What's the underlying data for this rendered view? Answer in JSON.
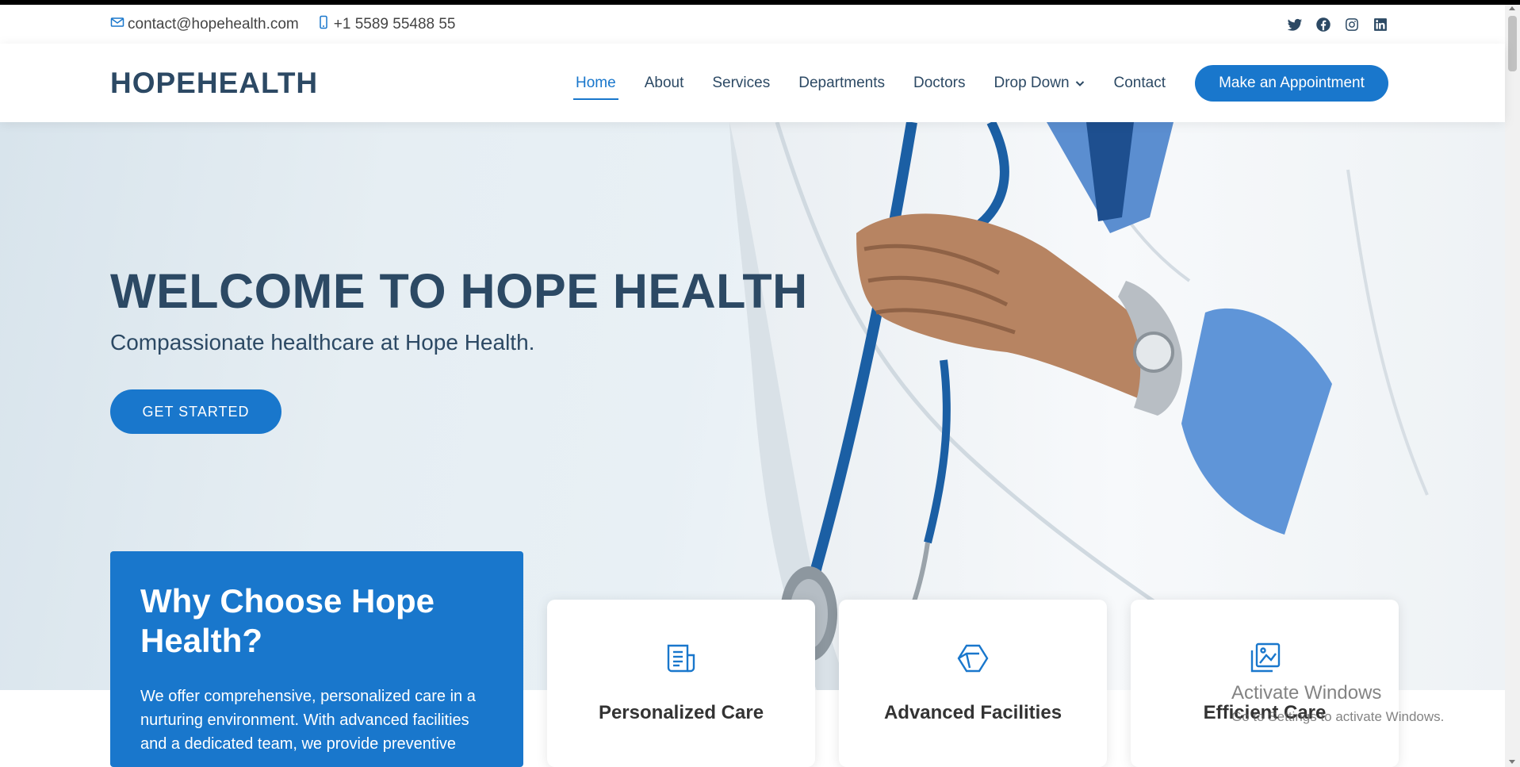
{
  "topbar": {
    "email": "contact@hopehealth.com",
    "phone": "+1 5589 55488 55",
    "social_icons": [
      "twitter-icon",
      "facebook-icon",
      "instagram-icon",
      "linkedin-icon"
    ]
  },
  "header": {
    "logo": "HOPEHEALTH",
    "nav": [
      "Home",
      "About",
      "Services",
      "Departments",
      "Doctors",
      "Drop Down",
      "Contact"
    ],
    "active_nav": "Home",
    "cta": "Make an Appointment"
  },
  "hero": {
    "title": "WELCOME TO HOPE HEALTH",
    "subtitle": "Compassionate healthcare at Hope Health.",
    "button": "GET STARTED"
  },
  "why": {
    "title": "Why Choose Hope Health?",
    "body": "We offer comprehensive, personalized care in a nurturing environment. With advanced facilities and a dedicated team, we provide preventive"
  },
  "cards": [
    {
      "icon": "document-icon",
      "title": "Personalized Care"
    },
    {
      "icon": "cube-icon",
      "title": "Advanced Facilities"
    },
    {
      "icon": "images-icon",
      "title": "Efficient Care"
    }
  ],
  "watermark": {
    "line1": "Activate Windows",
    "line2": "Go to Settings to activate Windows."
  },
  "colors": {
    "accent": "#1977cc",
    "heading": "#2c4964"
  }
}
